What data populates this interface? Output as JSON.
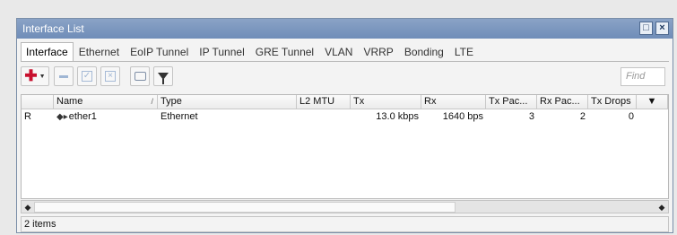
{
  "window": {
    "title": "Interface List"
  },
  "tabs": [
    "Interface",
    "Ethernet",
    "EoIP Tunnel",
    "IP Tunnel",
    "GRE Tunnel",
    "VLAN",
    "VRRP",
    "Bonding",
    "LTE"
  ],
  "toolbar": {
    "find_placeholder": "Find"
  },
  "table": {
    "columns": [
      "",
      "Name",
      "Type",
      "L2 MTU",
      "Tx",
      "Rx",
      "Tx Pac...",
      "Rx Pac...",
      "Tx Drops"
    ],
    "rows": [
      {
        "flag": "R",
        "name": "ether1",
        "type": "Ethernet",
        "l2mtu": "",
        "tx": "13.0 kbps",
        "rx": "1640 bps",
        "tx_packets": "3",
        "rx_packets": "2",
        "tx_drops": "0"
      }
    ]
  },
  "status": {
    "text": "2 items"
  },
  "colors": {
    "titlebar": "#7f98bf",
    "add_icon": "#c8102e"
  }
}
